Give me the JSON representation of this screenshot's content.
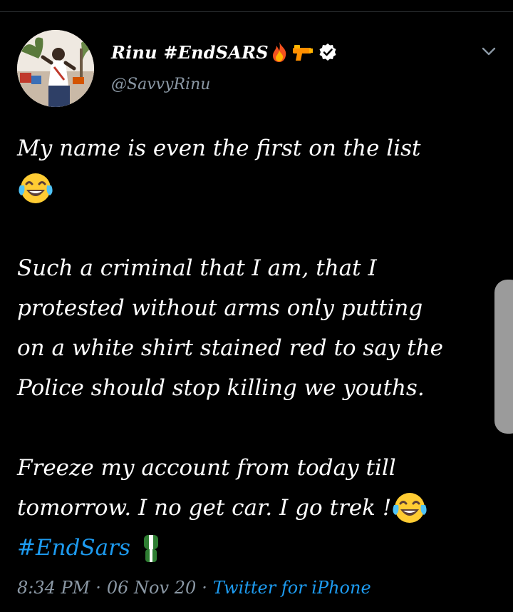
{
  "tweet": {
    "author": {
      "display_name": "Rinu #EndSARS",
      "handle": "@SavvyRinu",
      "name_emojis": [
        "fire-emoji",
        "water-gun-emoji"
      ],
      "verified": true
    },
    "lines": [
      "My name is even the first on the list",
      "",
      "",
      "Such a criminal that I am, that I",
      "protested without arms only putting",
      "on a white shirt stained red to say the",
      "Police should stop killing we youths.",
      "",
      "Freeze my account from today till",
      "tomorrow. I no get car. I go trek !",
      "#EndSars"
    ],
    "meta": {
      "time": "8:34 PM",
      "separator": "·",
      "date": "06 Nov 20",
      "source": "Twitter for iPhone"
    }
  },
  "colors": {
    "background": "#000000",
    "text": "#ffffff",
    "secondary_text": "#8b98a5",
    "link": "#1d9bf0",
    "divider": "#2f3336",
    "scroll_handle": "#9b9b9b"
  },
  "icons": [
    "caret-down-icon",
    "verified-badge-icon",
    "tears-of-joy-emoji",
    "raised-fist-flag-emoji"
  ]
}
